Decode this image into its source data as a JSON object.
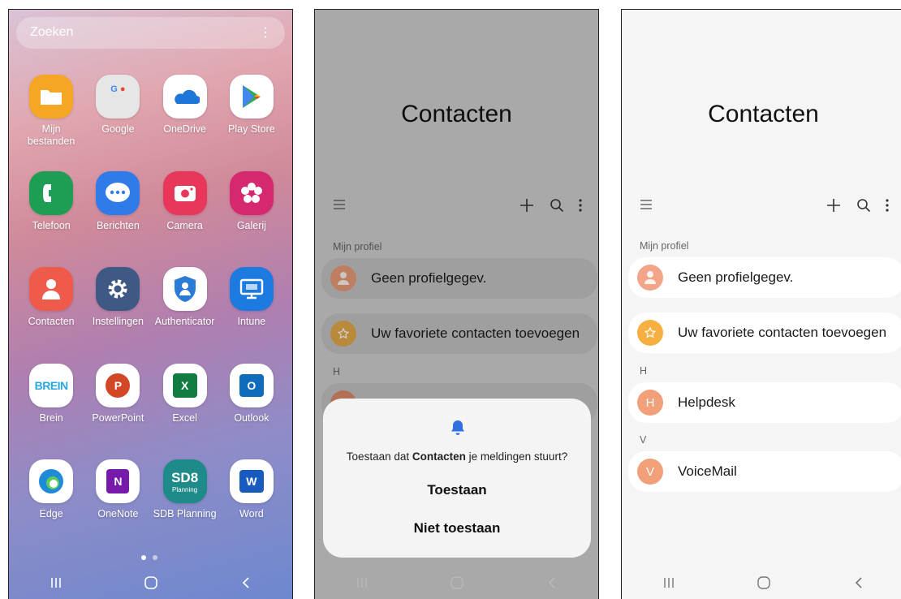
{
  "launcher": {
    "search_placeholder": "Zoeken",
    "menu_glyph": "⋮",
    "apps": [
      {
        "label": "Mijn\nbestanden",
        "icon": "folder-icon",
        "color": "#f5a623"
      },
      {
        "label": "Google",
        "icon": "google-folder-icon",
        "color": "#e6e6e6"
      },
      {
        "label": "OneDrive",
        "icon": "onedrive-icon",
        "color": "#ffffff"
      },
      {
        "label": "Play Store",
        "icon": "play-store-icon",
        "color": "#ffffff"
      },
      {
        "label": "Telefoon",
        "icon": "phone-icon",
        "color": "#1e9e55"
      },
      {
        "label": "Berichten",
        "icon": "chat-bubble-icon",
        "color": "#2f7bea"
      },
      {
        "label": "Camera",
        "icon": "camera-icon",
        "color": "#e8375b"
      },
      {
        "label": "Galerij",
        "icon": "flower-icon",
        "color": "#d6286e"
      },
      {
        "label": "Contacten",
        "icon": "contact-person-icon",
        "color": "#ef5b4a"
      },
      {
        "label": "Instellingen",
        "icon": "gear-icon",
        "color": "#3e5a84"
      },
      {
        "label": "Authenticator",
        "icon": "authenticator-icon",
        "color": "#ffffff"
      },
      {
        "label": "Intune",
        "icon": "intune-icon",
        "color": "#1d7ae0"
      },
      {
        "label": "Brein",
        "icon": "brein-logo-icon",
        "color": "#ffffff"
      },
      {
        "label": "PowerPoint",
        "icon": "powerpoint-icon",
        "color": "#ffffff"
      },
      {
        "label": "Excel",
        "icon": "excel-icon",
        "color": "#ffffff"
      },
      {
        "label": "Outlook",
        "icon": "outlook-icon",
        "color": "#ffffff"
      },
      {
        "label": "Edge",
        "icon": "edge-icon",
        "color": "#ffffff"
      },
      {
        "label": "OneNote",
        "icon": "onenote-icon",
        "color": "#ffffff"
      },
      {
        "label": "SDB Planning",
        "icon": "sdb-planning-icon",
        "color": "#1f8a8a"
      },
      {
        "label": "Word",
        "icon": "word-icon",
        "color": "#ffffff"
      }
    ],
    "brein_text": "BREIN",
    "ppt_letter": "P",
    "excel_letter": "X",
    "outlook_letter": "O",
    "onenote_letter": "N",
    "word_letter": "W",
    "sdb_text": "SD8",
    "sdb_sub": "Planning",
    "google_letters": "G"
  },
  "contacts": {
    "title": "Contacten",
    "my_profile_label": "Mijn profiel",
    "no_profile": "Geen profielgegev.",
    "add_favorites": "Uw favoriete contacten toevoegen",
    "section_h": "H",
    "section_v": "V",
    "contacts": [
      {
        "initial": "H",
        "name": "Helpdesk"
      },
      {
        "initial": "V",
        "name": "VoiceMail"
      }
    ],
    "accent_orange": "#f0a070",
    "star_color": "#f5b041"
  },
  "dialog": {
    "question_pre": "Toestaan dat ",
    "question_app": "Contacten",
    "question_post": " je meldingen stuurt?",
    "allow": "Toestaan",
    "deny": "Niet toestaan",
    "bell_color": "#2f6fe0"
  }
}
